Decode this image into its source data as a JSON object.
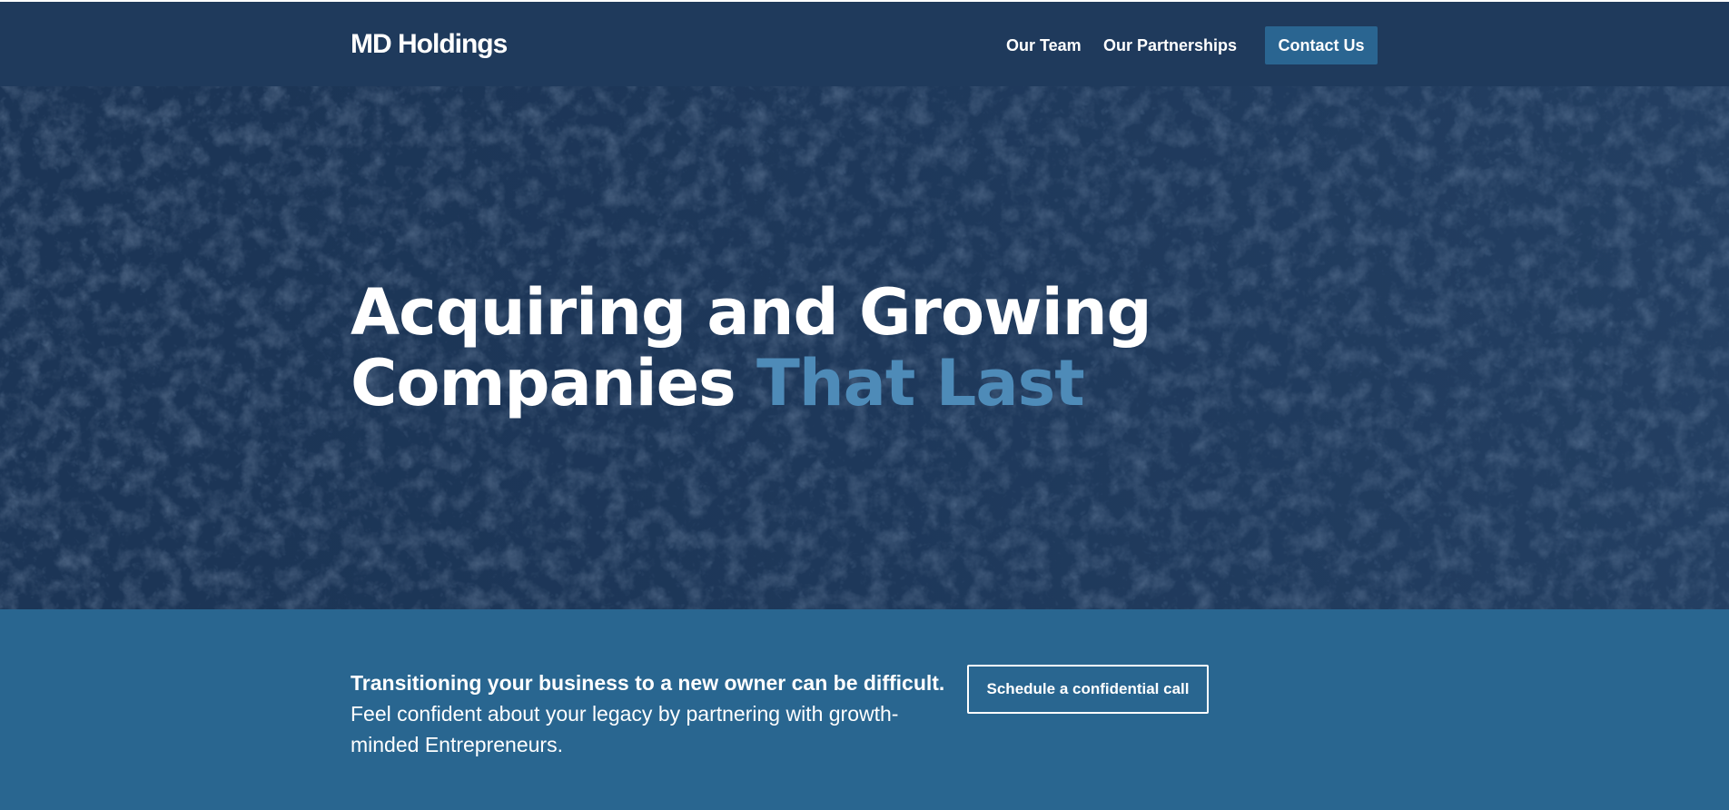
{
  "header": {
    "logo": "MD Holdings",
    "nav": {
      "our_team": "Our Team",
      "our_partnerships": "Our Partnerships"
    },
    "contact_button": "Contact Us"
  },
  "hero": {
    "title_line1": "Acquiring and Growing",
    "title_line2_start": "Companies ",
    "title_line2_accent": "That Last"
  },
  "cta": {
    "bold_text": "Transitioning your business to a new owner can be difficult.",
    "body_text": "Feel confident about your legacy by partnering with growth-minded Entrepreneurs.",
    "schedule_button": "Schedule a confidential call"
  },
  "colors": {
    "header_bg": "#1f3a5c",
    "hero_bg": "#1c3556",
    "accent": "#4e8bb8",
    "button_bg": "#2a6591",
    "cta_band_bg": "#296690",
    "text": "#ffffff"
  }
}
